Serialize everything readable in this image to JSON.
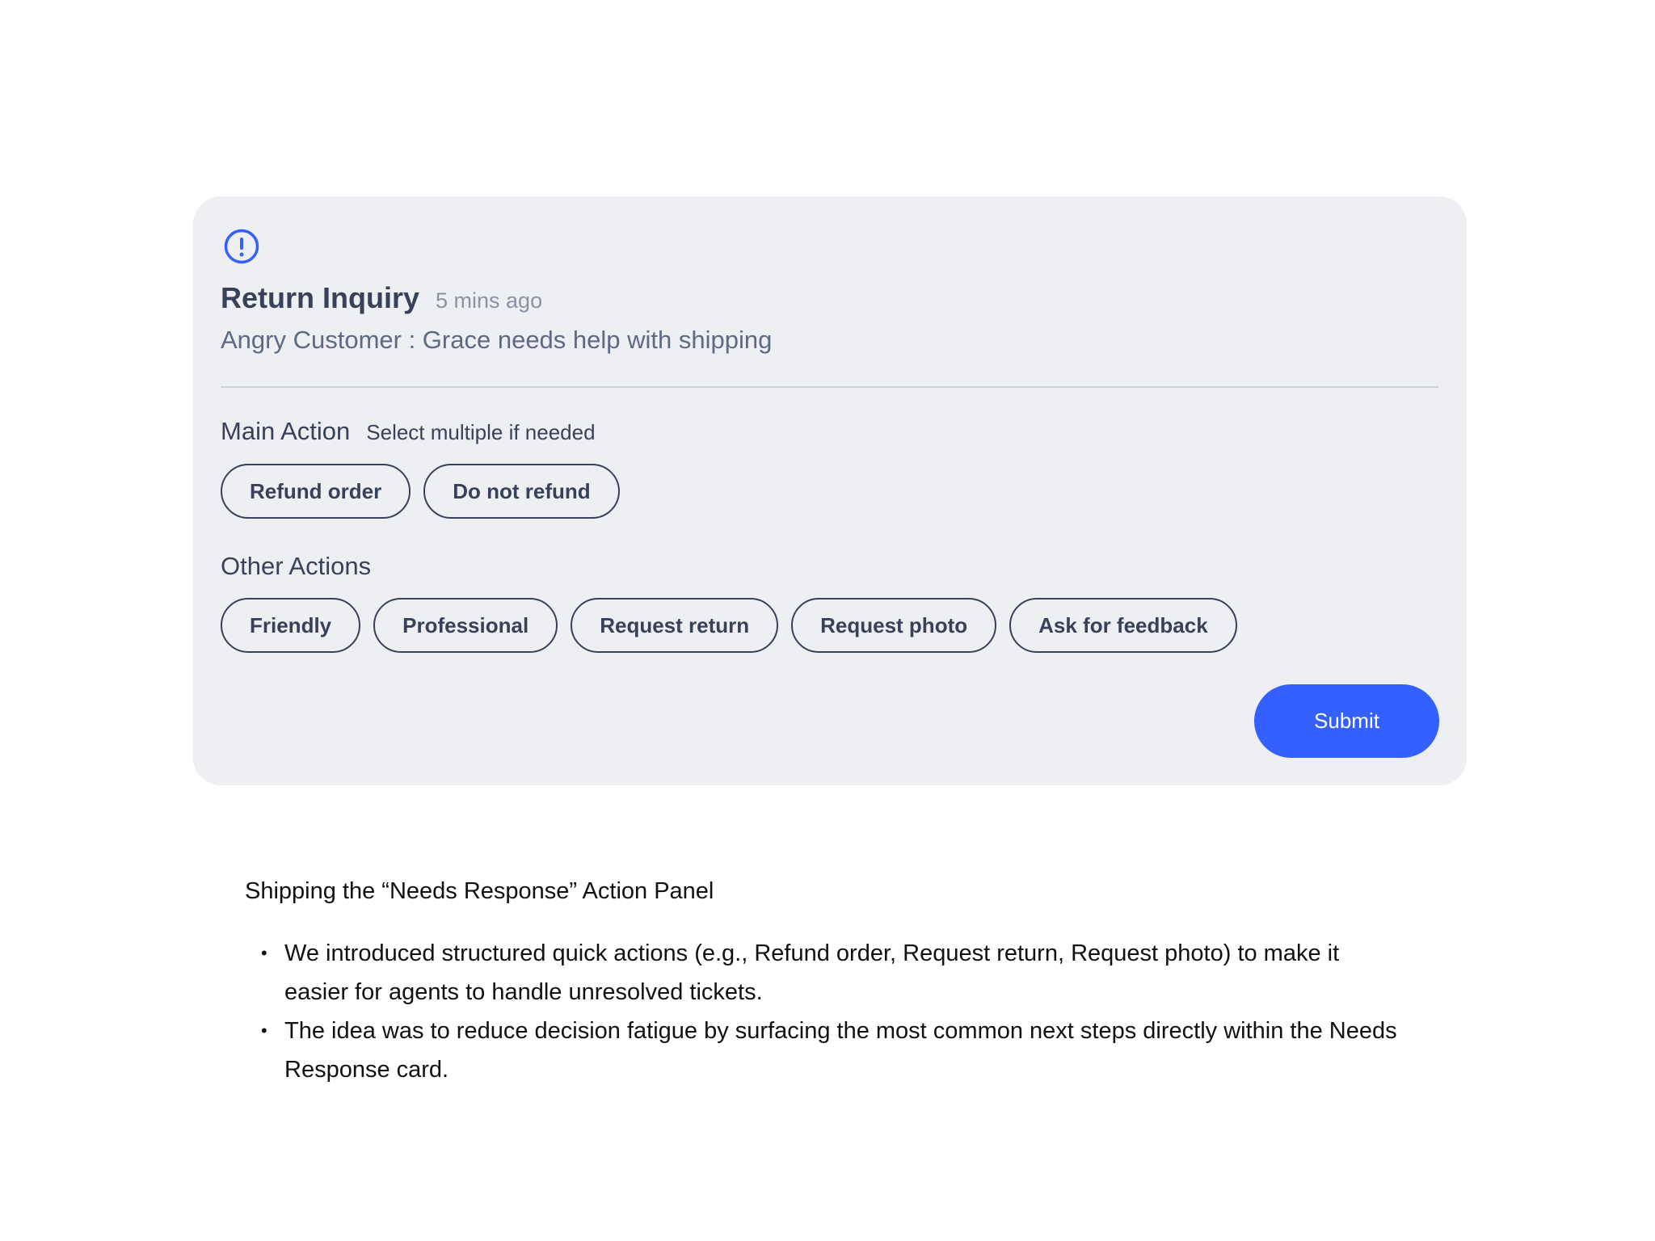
{
  "card": {
    "icon": "exclamation-circle-icon",
    "title": "Return Inquiry",
    "time_ago": "5 mins ago",
    "subtitle": "Angry Customer : Grace needs help with shipping",
    "main_action": {
      "label": "Main Action",
      "hint": "Select multiple if needed",
      "chips": [
        "Refund order",
        "Do not refund"
      ]
    },
    "other_actions": {
      "label": "Other Actions",
      "chips": [
        "Friendly",
        "Professional",
        "Request return",
        "Request photo",
        "Ask for feedback"
      ]
    },
    "submit_label": "Submit"
  },
  "notes": {
    "heading": "Shipping the “Needs Response” Action Panel",
    "bullets": [
      "We introduced structured quick actions (e.g., Refund order, Request return, Request photo) to make it easier for agents to handle unresolved tickets.",
      "The idea was to reduce decision fatigue by surfacing the most common next steps directly within the Needs Response card."
    ]
  },
  "colors": {
    "card_bg": "#eeeff2",
    "text_primary": "#37425a",
    "accent": "#3360ff",
    "icon": "#3360ff"
  }
}
